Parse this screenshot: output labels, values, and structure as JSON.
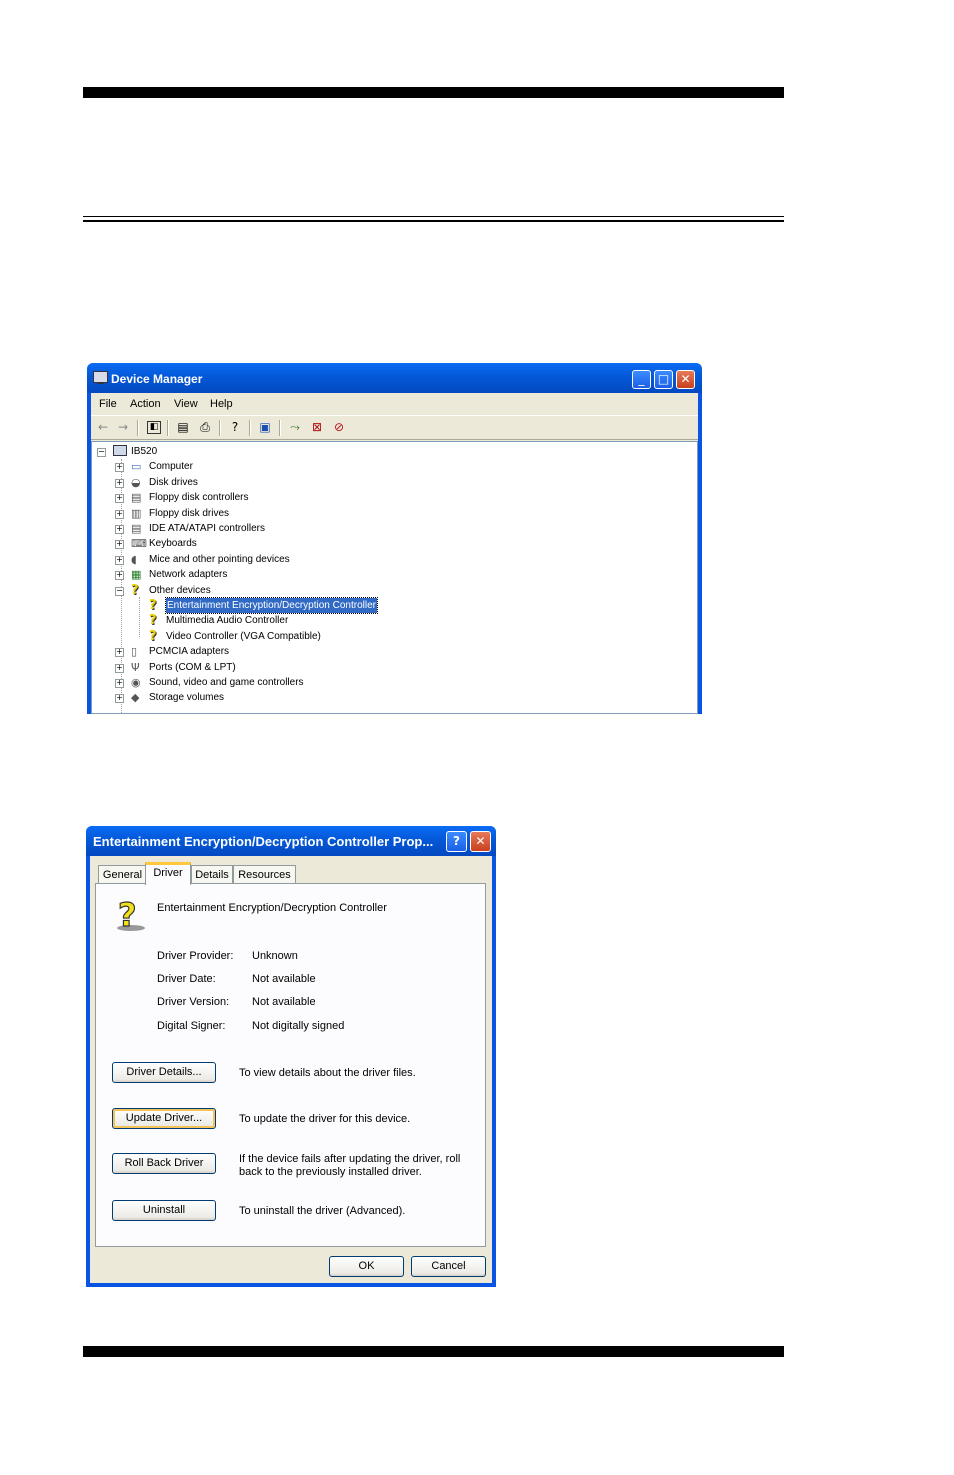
{
  "device_manager": {
    "title": "Device Manager",
    "menu": [
      "File",
      "Action",
      "View",
      "Help"
    ],
    "toolbar_icons": [
      "back-arrow-icon",
      "forward-arrow-icon",
      "show-hide-tree-icon",
      "properties-icon",
      "print-icon",
      "help-icon",
      "scan-hardware-icon",
      "update-driver-icon",
      "uninstall-icon",
      "disable-icon"
    ],
    "tree": {
      "root": "IB520",
      "items": [
        {
          "label": "Computer",
          "icon": "computer-icon",
          "expanded": false
        },
        {
          "label": "Disk drives",
          "icon": "disk-drive-icon",
          "expanded": false
        },
        {
          "label": "Floppy disk controllers",
          "icon": "floppy-controller-icon",
          "expanded": false
        },
        {
          "label": "Floppy disk drives",
          "icon": "floppy-drive-icon",
          "expanded": false
        },
        {
          "label": "IDE ATA/ATAPI controllers",
          "icon": "ide-controller-icon",
          "expanded": false
        },
        {
          "label": "Keyboards",
          "icon": "keyboard-icon",
          "expanded": false
        },
        {
          "label": "Mice and other pointing devices",
          "icon": "mouse-icon",
          "expanded": false
        },
        {
          "label": "Network adapters",
          "icon": "network-adapter-icon",
          "expanded": false
        },
        {
          "label": "Other devices",
          "icon": "unknown-device-icon",
          "expanded": true,
          "children": [
            {
              "label": "Entertainment Encryption/Decryption Controller",
              "selected": true
            },
            {
              "label": "Multimedia Audio Controller"
            },
            {
              "label": "Video Controller (VGA Compatible)"
            }
          ]
        },
        {
          "label": "PCMCIA adapters",
          "icon": "pcmcia-icon",
          "expanded": false
        },
        {
          "label": "Ports (COM & LPT)",
          "icon": "port-icon",
          "expanded": false
        },
        {
          "label": "Sound, video and game controllers",
          "icon": "sound-icon",
          "expanded": false
        },
        {
          "label": "Storage volumes",
          "icon": "storage-icon",
          "expanded": false
        }
      ]
    }
  },
  "properties": {
    "title": "Entertainment Encryption/Decryption Controller Prop...",
    "tabs": [
      "General",
      "Driver",
      "Details",
      "Resources"
    ],
    "active_tab": "Driver",
    "device_name": "Entertainment Encryption/Decryption Controller",
    "fields": [
      {
        "label": "Driver Provider:",
        "value": "Unknown"
      },
      {
        "label": "Driver Date:",
        "value": "Not available"
      },
      {
        "label": "Driver Version:",
        "value": "Not available"
      },
      {
        "label": "Digital Signer:",
        "value": "Not digitally signed"
      }
    ],
    "actions": [
      {
        "button": "Driver Details...",
        "desc": "To view details about the driver files."
      },
      {
        "button": "Update Driver...",
        "desc": "To update the driver for this device."
      },
      {
        "button": "Roll Back Driver",
        "desc": "If the device fails after updating the driver, roll",
        "desc2": "back to the previously installed driver."
      },
      {
        "button": "Uninstall",
        "desc": "To uninstall the driver (Advanced)."
      }
    ],
    "ok_label": "OK",
    "cancel_label": "Cancel"
  }
}
